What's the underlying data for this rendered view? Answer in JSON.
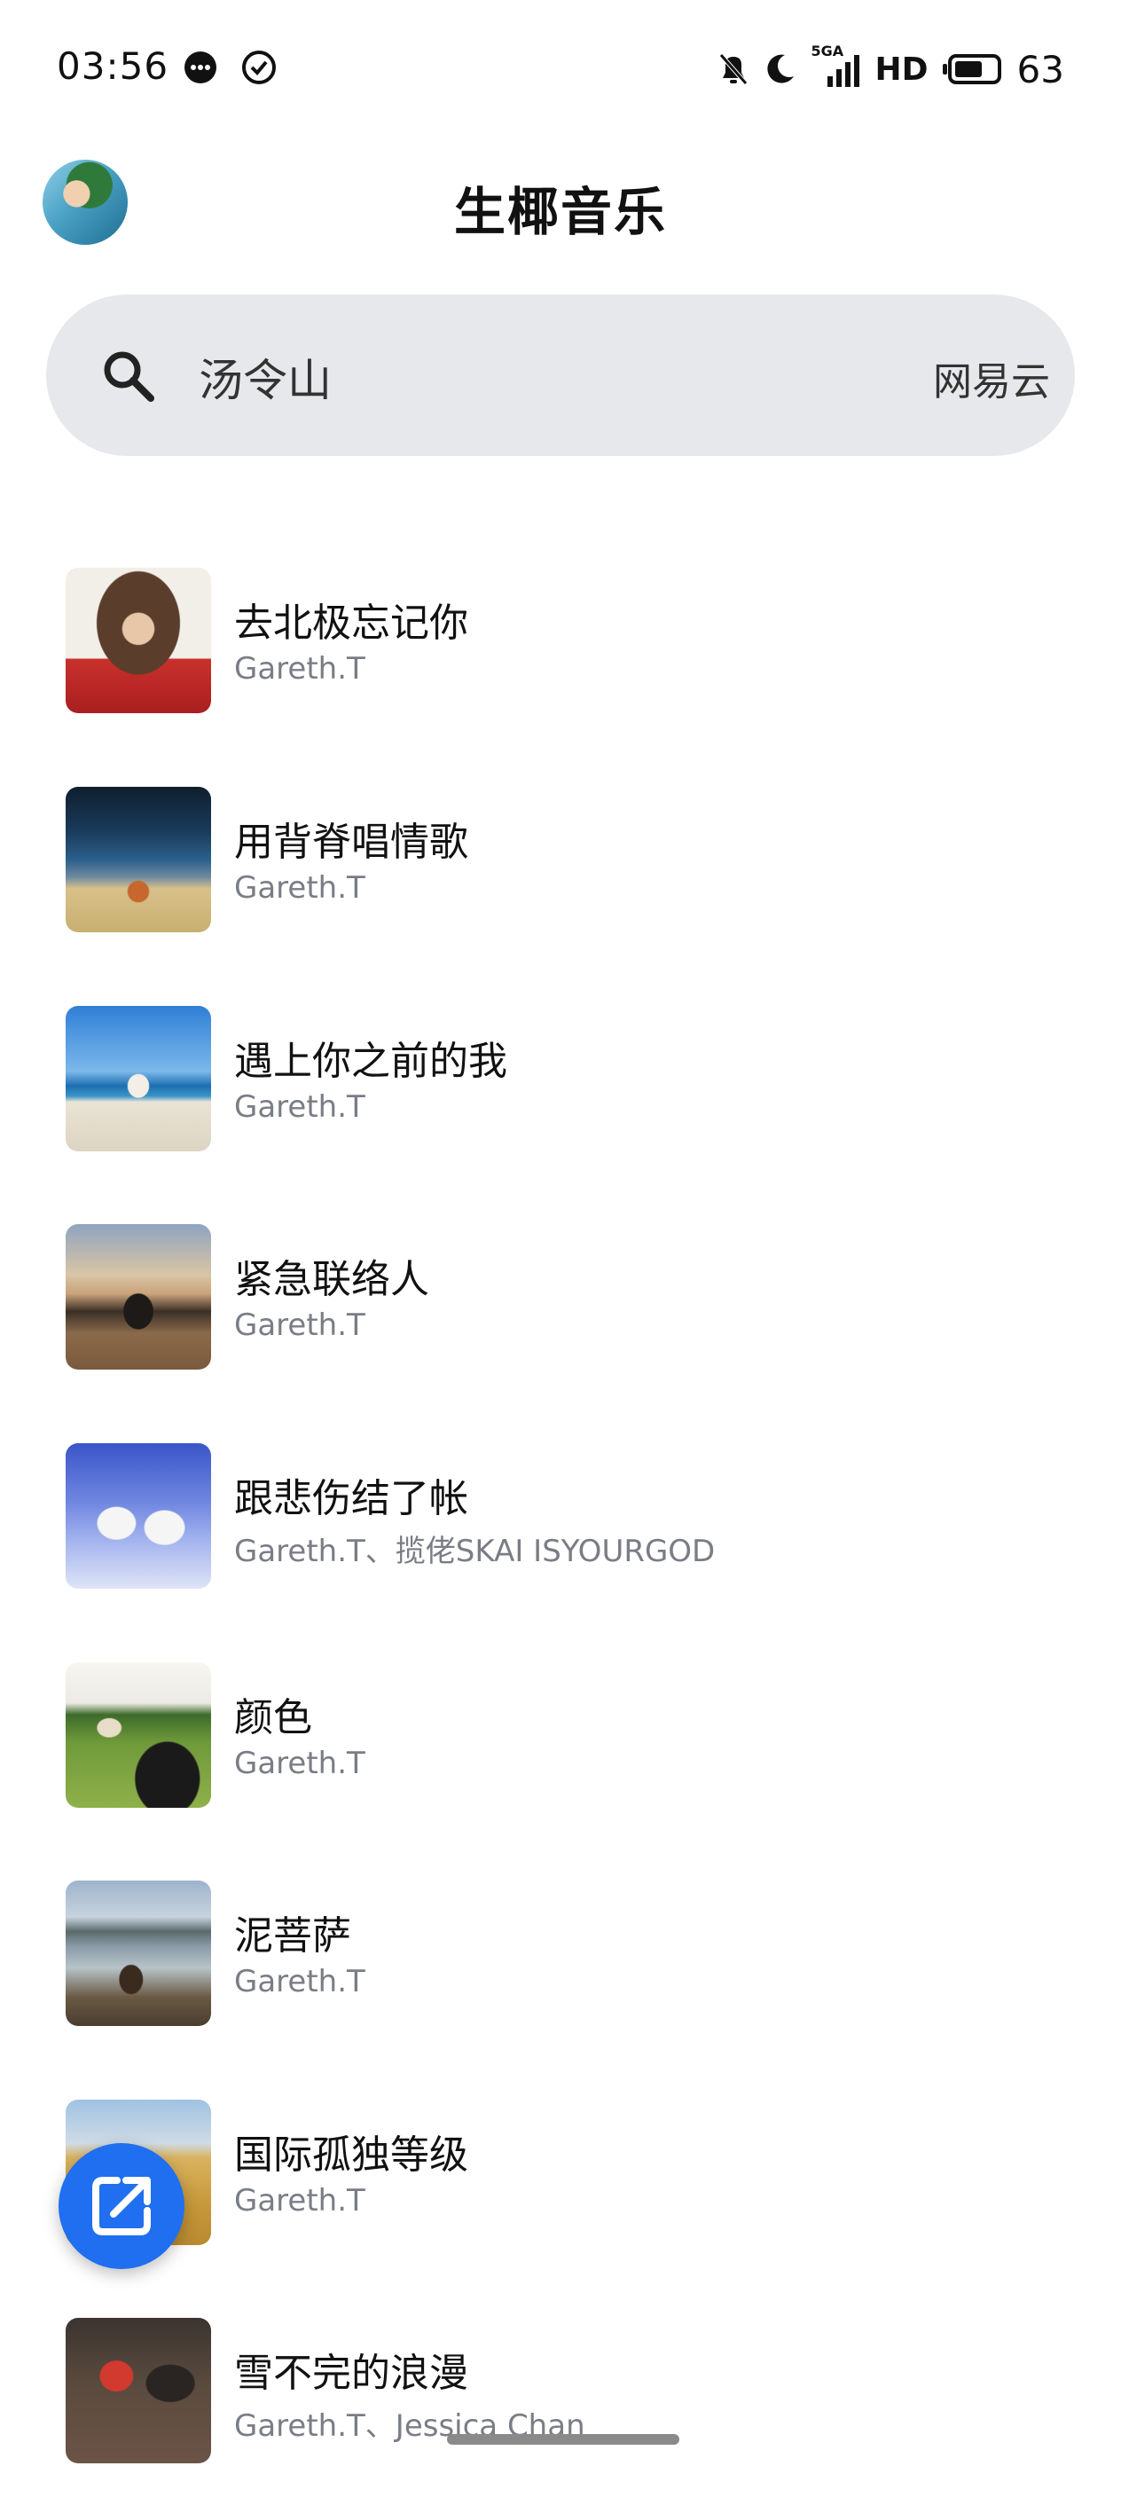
{
  "status_bar": {
    "time": "03:56",
    "network": "5GA",
    "hd": "HD",
    "battery_level": "63",
    "icons": [
      "chat-bubble-icon",
      "check-circle-icon",
      "mute-bell-icon",
      "moon-icon",
      "signal-icon",
      "battery-icon"
    ]
  },
  "header": {
    "title": "生椰音乐",
    "avatar": "avatar"
  },
  "search": {
    "query": "汤令山",
    "source": "网易云",
    "icon": "search-icon"
  },
  "songs": [
    {
      "title": "去北极忘记你",
      "artist": "Gareth.T"
    },
    {
      "title": "用背脊唱情歌",
      "artist": "Gareth.T"
    },
    {
      "title": "遇上你之前的我",
      "artist": "Gareth.T"
    },
    {
      "title": "紧急联络人",
      "artist": "Gareth.T"
    },
    {
      "title": "跟悲伤结了帐",
      "artist": "Gareth.T、揽佬SKAI ISYOURGOD"
    },
    {
      "title": "颜色",
      "artist": "Gareth.T"
    },
    {
      "title": "泥菩萨",
      "artist": "Gareth.T"
    },
    {
      "title": "国际孤独等级",
      "artist": "Gareth.T"
    },
    {
      "title": "雪不完的浪漫",
      "artist": "Gareth.T、Jessica Chan"
    }
  ],
  "fab": {
    "icon": "open-external-icon"
  },
  "colors": {
    "accent": "#1f6ff0",
    "search_bg": "#e7e8ec",
    "secondary_text": "#7a7d85"
  }
}
